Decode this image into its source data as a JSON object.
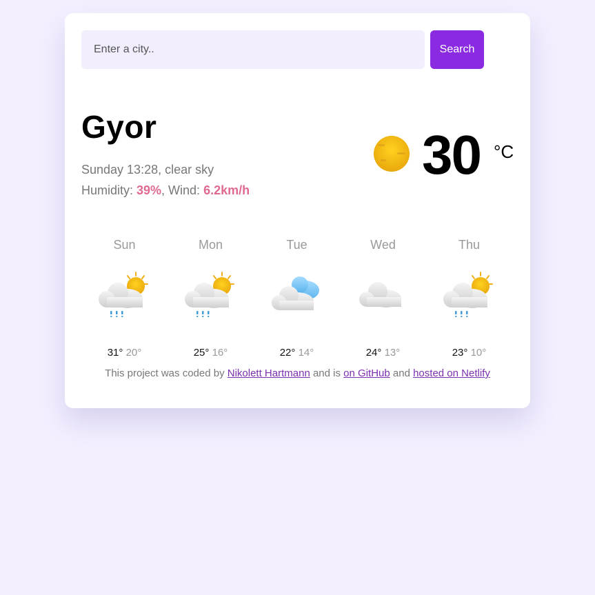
{
  "search": {
    "placeholder": "Enter a city..",
    "value": "",
    "button_label": "Search"
  },
  "current": {
    "city": "Gyor",
    "datetime_description": "Sunday 13:28, clear sky",
    "humidity_label": "Humidity: ",
    "humidity_value": "39%",
    "wind_label": ", Wind: ",
    "wind_value": "6.2km/h",
    "temperature": "30",
    "unit": "°C",
    "icon": "sun-icon"
  },
  "forecast": [
    {
      "day": "Sun",
      "max": "31°",
      "min": "20°",
      "icon": "sun-cloud-rain-icon"
    },
    {
      "day": "Mon",
      "max": "25°",
      "min": "16°",
      "icon": "sun-cloud-rain-icon"
    },
    {
      "day": "Tue",
      "max": "22°",
      "min": "14°",
      "icon": "clouds-icon"
    },
    {
      "day": "Wed",
      "max": "24°",
      "min": "13°",
      "icon": "cloud-icon"
    },
    {
      "day": "Thu",
      "max": "23°",
      "min": "10°",
      "icon": "sun-cloud-rain-icon"
    }
  ],
  "footer": {
    "prefix": "This project was coded by ",
    "author_link": "Nikolett Hartmann",
    "middle": " and is ",
    "github_link": "on GitHub",
    "and": " and ",
    "netlify_link": "hosted on Netlify"
  },
  "colors": {
    "background": "#f3efff",
    "accent": "#8a2be2",
    "highlight": "#e06a8f"
  }
}
